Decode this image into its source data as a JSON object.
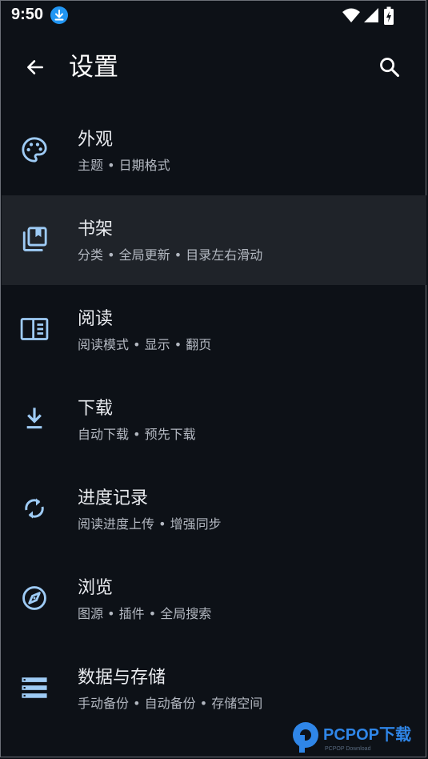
{
  "status_bar": {
    "time": "9:50",
    "icons": [
      "download-notification-icon",
      "wifi-icon",
      "signal-icon",
      "battery-charging-icon"
    ]
  },
  "app_bar": {
    "title": "设置",
    "back_icon": "arrow-back-icon",
    "search_icon": "search-icon"
  },
  "colors": {
    "background": "#0d1117",
    "selected_row": "#1f2329",
    "accent": "#9ecbf5",
    "download_badge": "#2196f3"
  },
  "settings": [
    {
      "title": "外观",
      "subtitle": "主题 • 日期格式",
      "icon": "palette-icon"
    },
    {
      "title": "书架",
      "subtitle": "分类 • 全局更新 • 目录左右滑动",
      "icon": "bookshelf-icon"
    },
    {
      "title": "阅读",
      "subtitle": "阅读模式 • 显示 • 翻页",
      "icon": "reader-icon"
    },
    {
      "title": "下载",
      "subtitle": "自动下载 • 预先下载",
      "icon": "download-icon"
    },
    {
      "title": "进度记录",
      "subtitle": "阅读进度上传 • 增强同步",
      "icon": "sync-icon"
    },
    {
      "title": "浏览",
      "subtitle": "图源 • 插件 • 全局搜索",
      "icon": "compass-icon"
    },
    {
      "title": "数据与存储",
      "subtitle": "手动备份 • 自动备份 • 存储空间",
      "icon": "storage-icon"
    }
  ],
  "watermark": {
    "brand": "PCPOP下载",
    "tagline": "PCPOP Download"
  }
}
